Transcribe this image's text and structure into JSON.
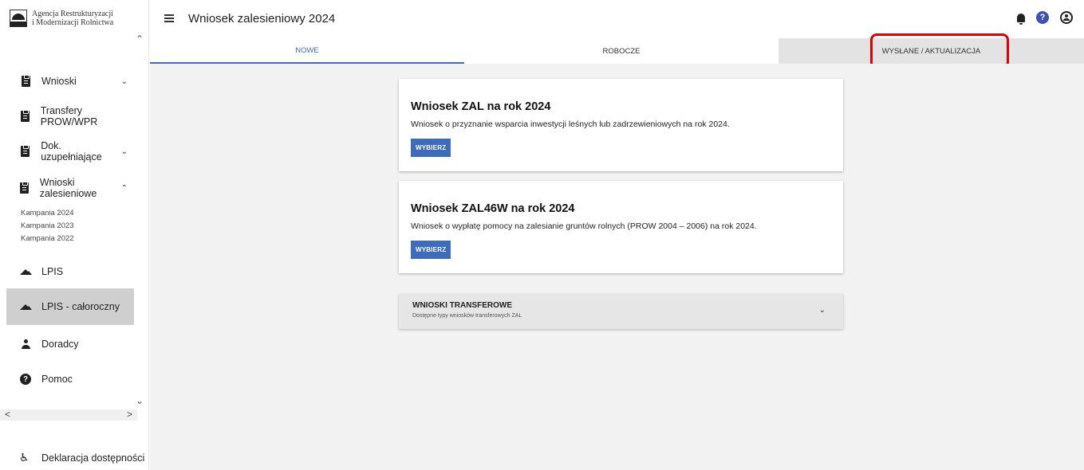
{
  "logo": {
    "line1": "Agencja Restrukturyzacji",
    "line2": "i Modernizacji Rolnictwa"
  },
  "header": {
    "title": "Wniosek zalesieniowy 2024"
  },
  "sidebar": {
    "items": [
      {
        "label": "Wnioski",
        "icon": "clipboard-icon"
      },
      {
        "label": "Transfery PROW/WPR",
        "icon": "clipboard-icon"
      },
      {
        "label": "Dok. uzupełniające",
        "icon": "clipboard-icon"
      },
      {
        "label": "Wnioski zalesieniowe",
        "icon": "clipboard-icon"
      },
      {
        "label": "LPIS",
        "icon": "terrain-icon"
      },
      {
        "label": "LPIS - całoroczny",
        "icon": "terrain-icon"
      },
      {
        "label": "Doradcy",
        "icon": "person-icon"
      },
      {
        "label": "Pomoc",
        "icon": "help-icon"
      }
    ],
    "campaigns": [
      "Kampania 2024",
      "Kampania 2023",
      "Kampania 2022"
    ],
    "accessibility": "Deklaracja dostępności"
  },
  "tabs": [
    {
      "label": "NOWE",
      "active": true
    },
    {
      "label": "ROBOCZE",
      "active": false
    },
    {
      "label": "WYSŁANE / AKTUALIZACJA",
      "active": false
    }
  ],
  "cards": [
    {
      "title": "Wniosek ZAL na rok 2024",
      "description": "Wniosek o przyznanie wsparcia inwestycji leśnych lub zadrzewieniowych na rok 2024.",
      "button": "WYBIERZ"
    },
    {
      "title": "Wniosek ZAL46W na rok 2024",
      "description": "Wniosek o wypłatę pomocy na zalesianie gruntów rolnych (PROW 2004 – 2006) na rok 2024.",
      "button": "WYBIERZ"
    }
  ],
  "accordion": {
    "title": "WNIOSKI TRANSFEROWE",
    "subtitle": "Dostępne typy wniosków transferowych ZAL"
  },
  "colors": {
    "accent": "#3f6bbd",
    "highlight": "#e00000",
    "active_nav": "#cfcfcf"
  }
}
